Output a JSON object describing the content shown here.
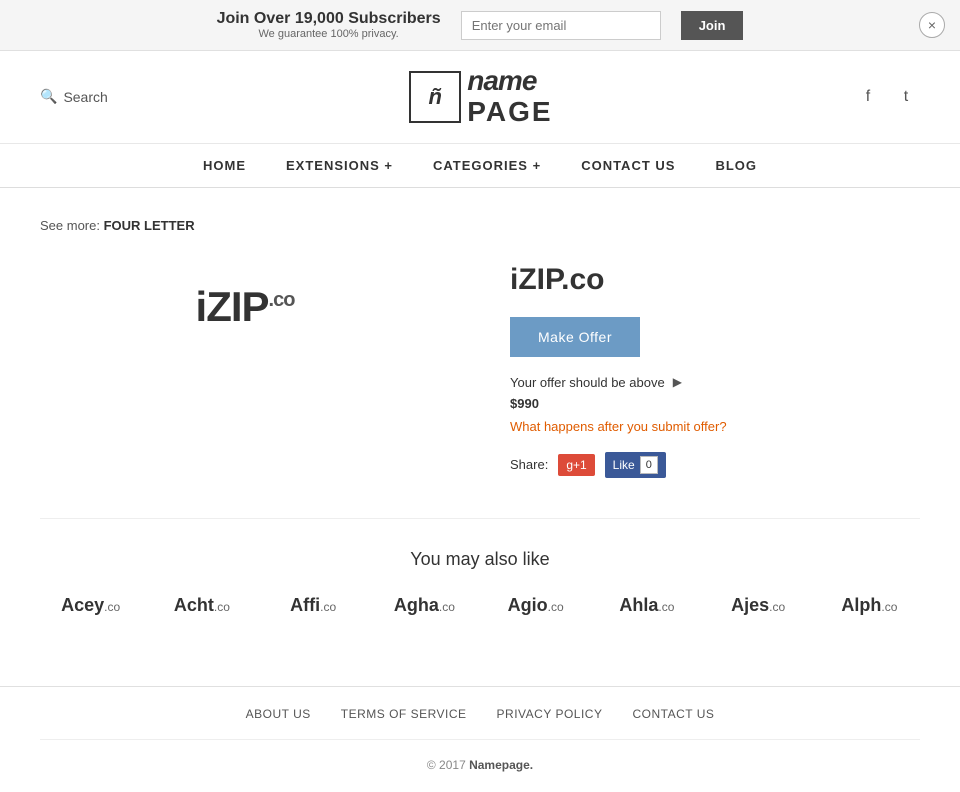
{
  "banner": {
    "title": "Join Over 19,000 Subscribers",
    "subtitle": "We guarantee 100% privacy.",
    "email_placeholder": "Enter your email",
    "join_label": "Join",
    "close_label": "×"
  },
  "header": {
    "search_label": "Search",
    "logo_icon": "ñ",
    "logo_name": "name",
    "logo_page": "PAGE",
    "facebook_icon": "f",
    "twitter_icon": "t"
  },
  "nav": {
    "items": [
      {
        "label": "HOME",
        "id": "home"
      },
      {
        "label": "EXTENSIONS +",
        "id": "extensions"
      },
      {
        "label": "CATEGORIES +",
        "id": "categories"
      },
      {
        "label": "CONTACT US",
        "id": "contact"
      },
      {
        "label": "BLOG",
        "id": "blog"
      }
    ]
  },
  "breadcrumb": {
    "see_more_label": "See more:",
    "category": "FOUR LETTER"
  },
  "domain": {
    "logo_main": "iZIP",
    "logo_ext": ".co",
    "full_name": "iZIP.co",
    "make_offer_label": "Make Offer",
    "offer_above_label": "Your offer should be above",
    "offer_price": "$990",
    "what_happens_label": "What happens after you submit offer?",
    "share_label": "Share:",
    "gplus_label": "g+1",
    "fb_label": "Like",
    "fb_count": "0"
  },
  "also_like": {
    "title": "You may also like",
    "items": [
      {
        "name": "Acey",
        "ext": ".co"
      },
      {
        "name": "Acht",
        "ext": ".co"
      },
      {
        "name": "Affi",
        "ext": ".co"
      },
      {
        "name": "Agha",
        "ext": ".co"
      },
      {
        "name": "Agio",
        "ext": ".co"
      },
      {
        "name": "Ahla",
        "ext": ".co"
      },
      {
        "name": "Ajes",
        "ext": ".co"
      },
      {
        "name": "Alph",
        "ext": ".co"
      }
    ]
  },
  "footer": {
    "links": [
      {
        "label": "ABOUT US",
        "id": "about"
      },
      {
        "label": "TERMS OF SERVICE",
        "id": "terms"
      },
      {
        "label": "PRIVACY POLICY",
        "id": "privacy"
      },
      {
        "label": "CONTACT US",
        "id": "contact"
      }
    ],
    "copyright_prefix": "© 2017",
    "copyright_brand": "Namepage.",
    "copyright_suffix": ""
  }
}
